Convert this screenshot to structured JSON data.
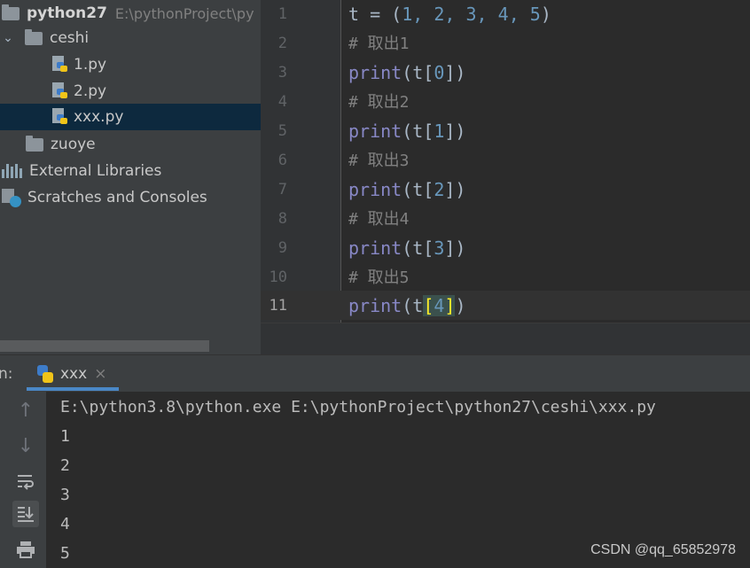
{
  "project_tree": {
    "root_name": "python27",
    "root_path": "E:\\pythonProject\\py",
    "folder_ceshi": "ceshi",
    "files": [
      "1.py",
      "2.py",
      "xxx.py"
    ],
    "selected_file": "xxx.py",
    "folder_zuoye": "zuoye",
    "external_libraries": "External Libraries",
    "scratches": "Scratches and Consoles"
  },
  "editor": {
    "line_numbers": [
      "1",
      "2",
      "3",
      "4",
      "5",
      "6",
      "7",
      "8",
      "9",
      "10",
      "11"
    ],
    "current_line": "11",
    "line1": {
      "prefix": "t = (",
      "n1": "1",
      "n2": "2",
      "n3": "3",
      "n4": "4",
      "n5": "5",
      "suffix": ")"
    },
    "comments": [
      "# 取出1",
      "# 取出2",
      "# 取出3",
      "# 取出4",
      "# 取出5"
    ],
    "print_kw": "print",
    "print_indices": [
      "0",
      "1",
      "2",
      "3",
      "4"
    ]
  },
  "run_panel": {
    "label": "n:",
    "tab_label": "xxx",
    "tab_close": "×",
    "command": "E:\\python3.8\\python.exe E:\\pythonProject\\python27\\ceshi\\xxx.py",
    "output": [
      "1",
      "2",
      "3",
      "4",
      "5"
    ]
  },
  "toolbar_icons": [
    "up-arrow-icon",
    "down-arrow-icon",
    "soft-wrap-icon",
    "scroll-to-end-icon",
    "print-icon"
  ],
  "watermark": "CSDN @qq_65852978",
  "colors": {
    "keyword": "#8888c6",
    "number": "#6897bb",
    "comment": "#808080",
    "bracket_highlight": "#ffef28",
    "selection": "#0d293e"
  }
}
